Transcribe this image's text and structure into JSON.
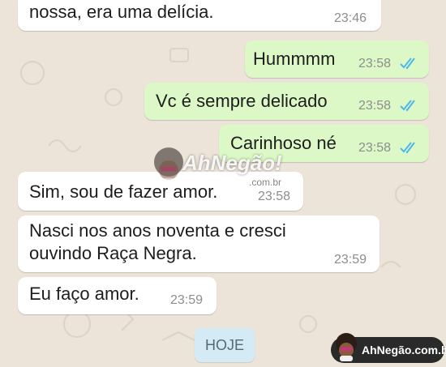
{
  "messages": [
    {
      "text": "nossa, era uma delícia.",
      "time": "23:46",
      "direction": "incoming"
    },
    {
      "text": "Hummmm",
      "time": "23:58",
      "direction": "outgoing",
      "status": "read"
    },
    {
      "text": "Vc é sempre delicado",
      "time": "23:58",
      "direction": "outgoing",
      "status": "read"
    },
    {
      "text": "Carinhoso né",
      "time": "23:58",
      "direction": "outgoing",
      "status": "read"
    },
    {
      "text": "Sim, sou de fazer amor.",
      "time": "23:58",
      "direction": "incoming"
    },
    {
      "text_line1": "Nasci nos anos noventa e cresci",
      "text_line2": "ouvindo Raça Negra.",
      "time": "23:59",
      "direction": "incoming"
    },
    {
      "text": "Eu faço amor.",
      "time": "23:59",
      "direction": "incoming"
    }
  ],
  "date_chip": "HOJE",
  "watermark": {
    "main": "AhNegão!",
    "sub": ".com.br"
  },
  "brand_badge": "AhNegão.com.br",
  "colors": {
    "incoming": "#ffffff",
    "outgoing": "#dcf8c6",
    "read_ticks": "#4fb6ec",
    "background": "#ece4d9"
  },
  "icons": {
    "read_receipt": "double-check-icon"
  }
}
